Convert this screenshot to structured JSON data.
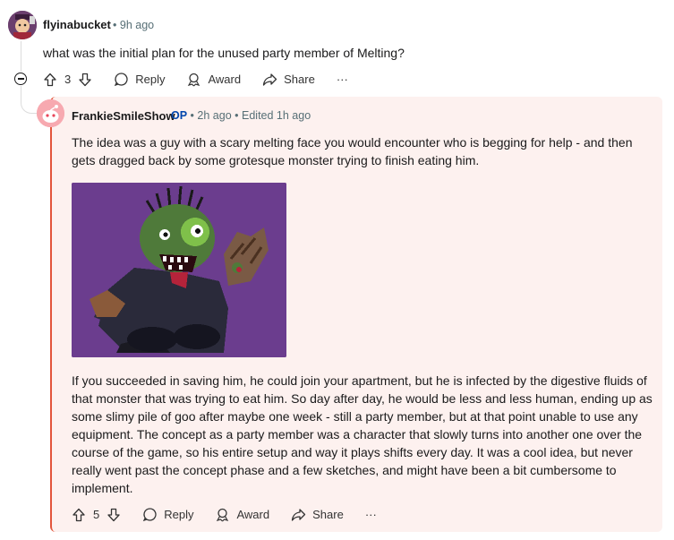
{
  "parent_comment": {
    "username": "flyinabucket",
    "time": "9h ago",
    "text": "what was the initial plan for the unused party member of Melting?",
    "upvotes": "3",
    "reply_label": "Reply",
    "award_label": "Award",
    "share_label": "Share",
    "more_label": "···"
  },
  "reply_comment": {
    "username": "FrankieSmileShow",
    "op_badge": "OP",
    "time": "2h ago",
    "edited": "Edited 1h ago",
    "paragraph1": "The idea was a guy with a scary melting face you would encounter who is begging for help - and then gets dragged back by some grotesque monster trying to finish eating him.",
    "paragraph2": "If you succeeded in saving him, he could join your apartment, but he is infected by the digestive fluids of that monster that was trying to eat him. So day after day, he would be less and less human, ending up as some slimy pile of goo after maybe one week - still a party member, but at that point unable to use any equipment. The concept as a party member was a character that slowly turns into another one over the course of the game, so his entire setup and way it plays shifts every day. It was a cool idea, but never really went past the concept phase and a few sketches, and might have been a bit cumbersome to implement.",
    "upvotes": "5",
    "reply_label": "Reply",
    "award_label": "Award",
    "share_label": "Share",
    "more_label": "···"
  },
  "colors": {
    "op_blue": "#0045ac",
    "highlight_bg": "#fdf1ef",
    "highlight_border": "#e2553b",
    "image_bg": "#6b3d8e"
  }
}
